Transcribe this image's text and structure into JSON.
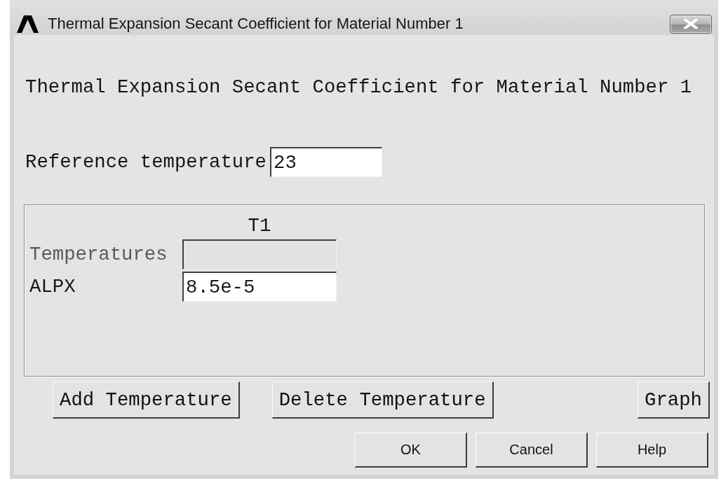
{
  "window": {
    "title": "Thermal Expansion Secant Coefficient for Material Number 1"
  },
  "heading": "Thermal Expansion Secant Coefficient for Material Number 1",
  "reference_temperature": {
    "label": "Reference temperature",
    "value": "23"
  },
  "table": {
    "columns": [
      "T1"
    ],
    "rows": [
      {
        "label": "Temperatures",
        "disabled": true
      },
      {
        "label": "ALPX",
        "disabled": false,
        "values": [
          "8.5e-5"
        ]
      }
    ]
  },
  "table_buttons": [
    "Add Temperature",
    "Delete Temperature",
    "Graph"
  ],
  "buttons": [
    "OK",
    "Cancel",
    "Help"
  ]
}
